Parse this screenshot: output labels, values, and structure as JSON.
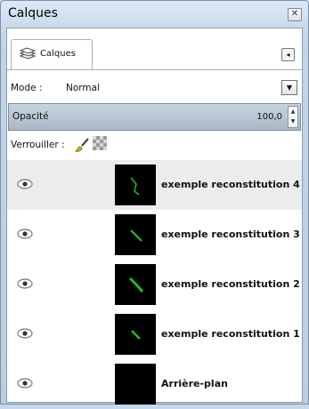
{
  "window": {
    "title": "Calques",
    "close_icon": "close-icon"
  },
  "tab": {
    "label": "Calques",
    "icon": "layers-icon"
  },
  "mode": {
    "label": "Mode :",
    "value": "Normal"
  },
  "opacity": {
    "label": "Opacité",
    "value": "100,0"
  },
  "lock": {
    "label": "Verrouiller :",
    "icons": [
      "lock-pixels-icon",
      "lock-alpha-icon"
    ]
  },
  "layers": [
    {
      "name": "exemple reconstitution 4",
      "visible": true,
      "selected": true
    },
    {
      "name": "exemple reconstitution 3",
      "visible": true,
      "selected": false
    },
    {
      "name": "exemple reconstitution 2",
      "visible": true,
      "selected": false
    },
    {
      "name": "exemple reconstitution 1",
      "visible": true,
      "selected": false
    },
    {
      "name": "Arrière-plan",
      "visible": true,
      "selected": false
    }
  ],
  "colors": {
    "accent": "#b9cde3",
    "selection": "#ececec",
    "thumb_content": "#1fbf1f"
  }
}
